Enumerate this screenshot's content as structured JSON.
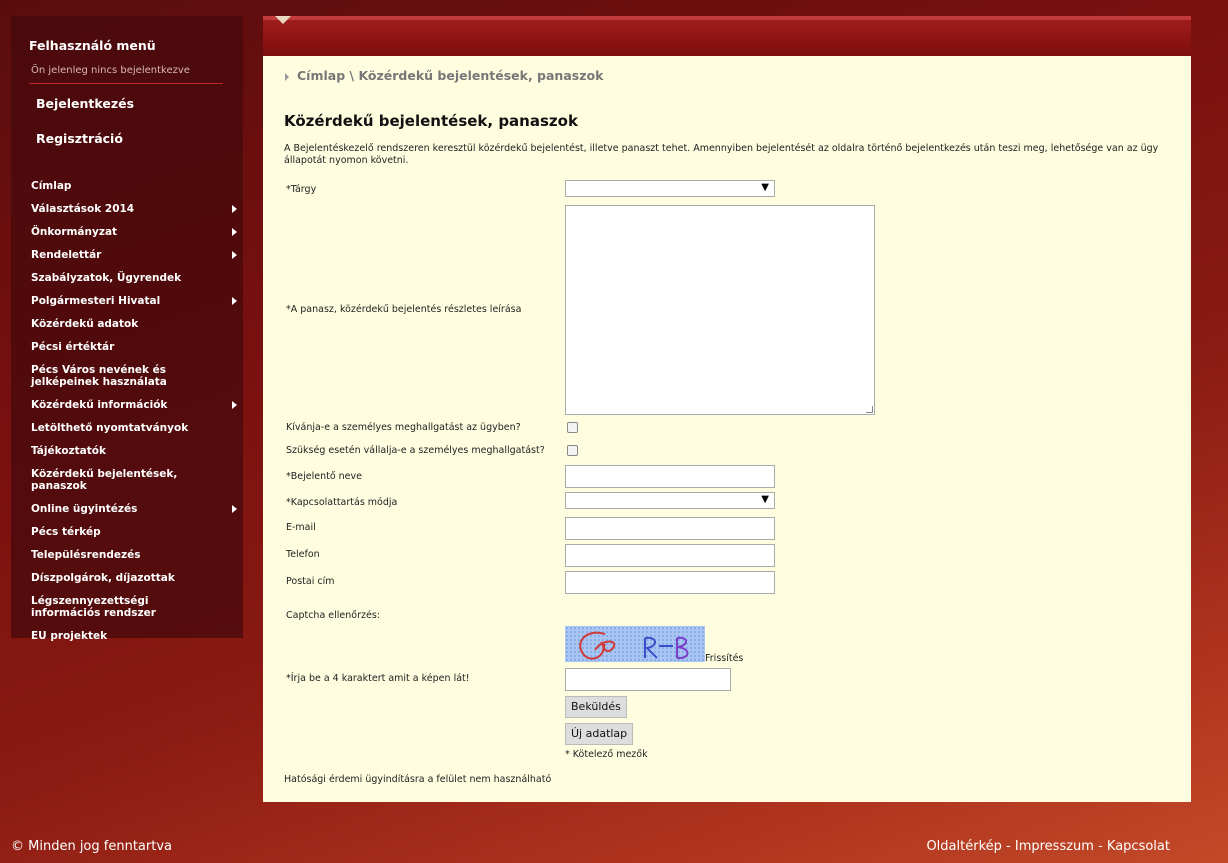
{
  "sidebar": {
    "title": "Felhasználó menü",
    "status": "Ön jelenleg nincs bejelentkezve",
    "login": "Bejelentkezés",
    "register": "Regisztráció",
    "nav": [
      {
        "label": "Címlap",
        "submenu": false
      },
      {
        "label": "Választások 2014",
        "submenu": true
      },
      {
        "label": "Önkormányzat",
        "submenu": true
      },
      {
        "label": "Rendelettár",
        "submenu": true
      },
      {
        "label": "Szabályzatok, Ügyrendek",
        "submenu": false
      },
      {
        "label": "Polgármesteri Hivatal",
        "submenu": true
      },
      {
        "label": "Közérdekű adatok",
        "submenu": false
      },
      {
        "label": "Pécsi értéktár",
        "submenu": false
      },
      {
        "label": "Pécs Város nevének és jelképeinek használata",
        "submenu": false
      },
      {
        "label": "Közérdekű információk",
        "submenu": true
      },
      {
        "label": "Letölthető nyomtatványok",
        "submenu": false
      },
      {
        "label": "Tájékoztatók",
        "submenu": false
      },
      {
        "label": "Közérdekű bejelentések, panaszok",
        "submenu": false
      },
      {
        "label": "Online ügyintézés",
        "submenu": true
      },
      {
        "label": "Pécs térkép",
        "submenu": false
      },
      {
        "label": "Településrendezés",
        "submenu": false
      },
      {
        "label": "Díszpolgárok, díjazottak",
        "submenu": false
      },
      {
        "label": "Légszennyezettségi információs rendszer",
        "submenu": false
      },
      {
        "label": "EU projektek",
        "submenu": false
      }
    ]
  },
  "breadcrumb": {
    "home": "Címlap",
    "separator": "\\",
    "current": "Közérdekű bejelentések, panaszok"
  },
  "page": {
    "title": "Közérdekű bejelentések, panaszok",
    "intro": "A Bejelentéskezelő rendszeren keresztül közérdekű bejelentést, illetve panaszt tehet. Amennyiben bejelentését az oldalra történő bejelentkezés után teszi meg, lehetősége van az ügy állapotát nyomon követni."
  },
  "form": {
    "subject_label": "*Tárgy",
    "subject_value": "",
    "description_label": "*A panasz, közérdekű bejelentés részletes leírása",
    "hearing_label": "Kívánja-e a személyes meghallgatást az ügyben?",
    "hearing_checked": false,
    "hearing_if_needed_label": "Szükség esetén vállalja-e a személyes meghallgatást?",
    "hearing_if_needed_checked": false,
    "name_label": "*Bejelentő neve",
    "contact_label": "*Kapcsolattartás módja",
    "contact_value": "",
    "email_label": "E-mail",
    "phone_label": "Telefon",
    "postal_label": "Postai cím",
    "captcha_heading": "Captcha ellenőrzés:",
    "captcha_refresh": "Frissítés",
    "captcha_input_label": "*Írja be a 4 karaktert amit a képen lát!",
    "submit": "Beküldés",
    "new_form": "Új adatlap",
    "required_note": "* Kötelező mezők",
    "footer_note": "Hatósági érdemi ügyindításra a felület nem használható"
  },
  "footer": {
    "copyright": "© Minden jog fenntartva",
    "sitemap": "Oldaltérkép",
    "sep": " - ",
    "impressum": "Impresszum",
    "contact": "Kapcsolat"
  },
  "colors": {
    "content_bg": "#fffde0",
    "header_red": "#8f1414",
    "sidebar_bg": "#46090c"
  }
}
